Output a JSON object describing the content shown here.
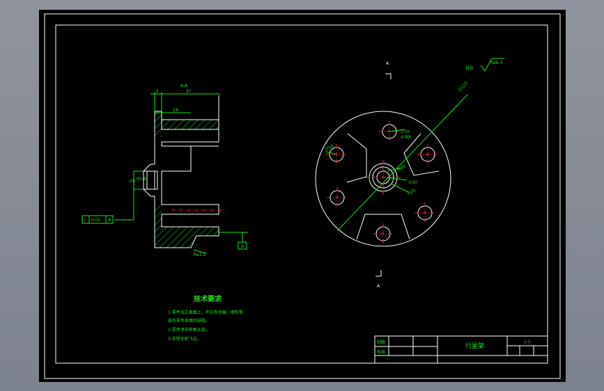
{
  "drawing": {
    "section_label": "A-A",
    "dim_overall": "47",
    "dim_step": "5",
    "dim_bore": "24",
    "dim_side": "∅8",
    "dim_left_small": "R0.8",
    "tolerance_symbol": "/",
    "tolerance_value": "0.02",
    "tolerance_datum": "A",
    "datum_marker": "A",
    "roughness_section": "Ra3.2",
    "roughness_top": "Ra6.3",
    "roughness_top_prefix": "其余",
    "cut_label_top": "A",
    "cut_label_bottom": "A",
    "dim_outer_dia": "∅110",
    "dim_hole_1": "∅10",
    "dim_hole_1b": "4-M8",
    "dim_hole_left": "∅16",
    "dim_center_1": "∅30",
    "dim_center_2": "∅10",
    "dim_center_3": "R20"
  },
  "notes": {
    "title": "技术要求",
    "lines": [
      "1.零件加工表面上，不应有划痕、擦伤等",
      "损伤零件表面的缺陷。",
      "2.零件须去除氧化皮。",
      "3.去除毛刺飞边。"
    ]
  },
  "title_block": {
    "row1_label": "制图",
    "row2_label": "校核",
    "part_name": "行星架",
    "scale": "1:1"
  },
  "colors": {
    "background": "#000000",
    "line": "#ffffff",
    "annotation": "#19e619",
    "centerline": "#ff2424",
    "viewport": "#8c919c"
  }
}
